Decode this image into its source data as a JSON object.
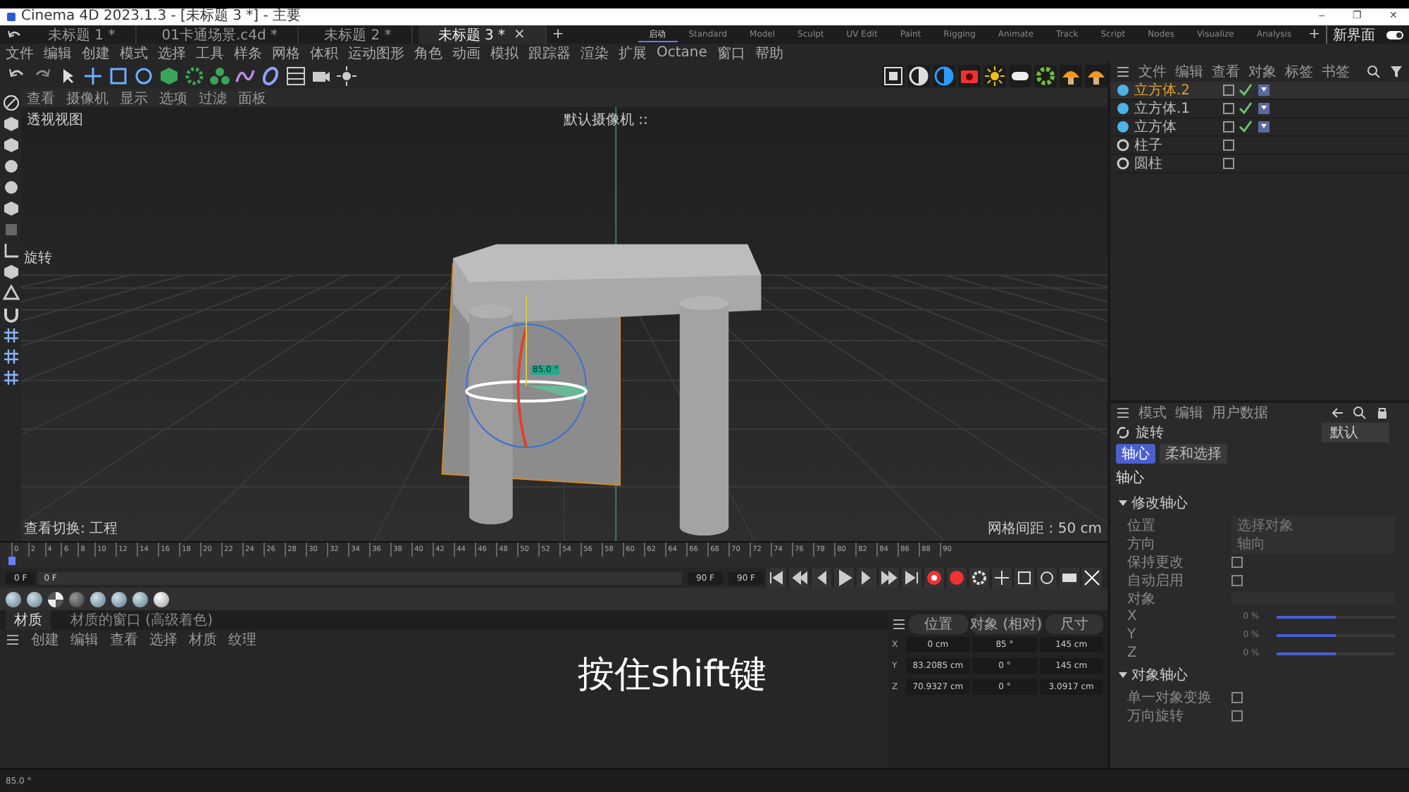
{
  "title_bar": {
    "title": "Cinema 4D 2023.1.3 - [未标题 3 *] - 主要",
    "controls": [
      "–",
      "❐",
      "✕"
    ]
  },
  "doc_tabs": {
    "items": [
      {
        "label": "未标题 1 *",
        "selected": false
      },
      {
        "label": "01卡通场景.c4d *",
        "selected": false
      },
      {
        "label": "未标题 2 *",
        "selected": false
      },
      {
        "label": "未标题 3 *",
        "selected": true
      }
    ],
    "close": "×",
    "add": "+"
  },
  "layouts": {
    "items": [
      {
        "label": "启动",
        "selected": true
      },
      {
        "label": "Standard",
        "selected": false
      },
      {
        "label": "Model",
        "selected": false
      },
      {
        "label": "Sculpt",
        "selected": false
      },
      {
        "label": "UV Edit",
        "selected": false
      },
      {
        "label": "Paint",
        "selected": false
      },
      {
        "label": "Rigging",
        "selected": false
      },
      {
        "label": "Animate",
        "selected": false
      },
      {
        "label": "Track",
        "selected": false
      },
      {
        "label": "Script",
        "selected": false
      },
      {
        "label": "Nodes",
        "selected": false
      },
      {
        "label": "Visualize",
        "selected": false
      },
      {
        "label": "Analysis",
        "selected": false
      }
    ],
    "add": "+",
    "new_layout": "新界面",
    "toggle_on": true
  },
  "menu": [
    "文件",
    "编辑",
    "创建",
    "模式",
    "选择",
    "工具",
    "样条",
    "网格",
    "体积",
    "运动图形",
    "角色",
    "动画",
    "模拟",
    "跟踪器",
    "渲染",
    "扩展",
    "Octane",
    "窗口",
    "帮助"
  ],
  "viewport": {
    "menu": [
      "查看",
      "摄像机",
      "显示",
      "选项",
      "过滤",
      "面板"
    ],
    "name": "透视视图",
    "camera": "默认摄像机 ::",
    "tool": "旋转",
    "grid": "网格间距 : 50 cm",
    "view_switch": "查看切换: 工程",
    "gizmo_label": "85.0 °"
  },
  "objects": {
    "menu": [
      "文件",
      "编辑",
      "查看",
      "对象",
      "标签",
      "书签"
    ],
    "items": [
      {
        "name": "立方体.2",
        "kind": "cube",
        "selected": true
      },
      {
        "name": "立方体.1",
        "kind": "cube",
        "selected": false
      },
      {
        "name": "立方体",
        "kind": "cube",
        "selected": false
      },
      {
        "name": "柱子",
        "kind": "null",
        "selected": false
      },
      {
        "name": "圆柱",
        "kind": "null",
        "selected": false
      }
    ]
  },
  "attributes": {
    "menu": [
      "模式",
      "编辑",
      "用户数据"
    ],
    "tool": "旋转",
    "preset": "默认",
    "tabs": [
      {
        "label": "轴心",
        "selected": true
      },
      {
        "label": "柔和选择",
        "selected": false
      }
    ],
    "heading": "轴心",
    "sections": [
      {
        "title": "修改轴心",
        "expanded": true,
        "rows": [
          {
            "kind": "dropdown",
            "label": "位置",
            "value": "选择对象"
          },
          {
            "kind": "dropdown",
            "label": "方向",
            "value": "轴向"
          },
          {
            "kind": "checkbox",
            "label": "保持更改",
            "checked": false
          },
          {
            "kind": "checkbox",
            "label": "自动启用",
            "checked": false
          },
          {
            "kind": "link",
            "label": "对象"
          },
          {
            "kind": "slider",
            "label": "X",
            "value": "0 %",
            "level": 0.5
          },
          {
            "kind": "slider",
            "label": "Y",
            "value": "0 %",
            "level": 0.5
          },
          {
            "kind": "slider",
            "label": "Z",
            "value": "0 %",
            "level": 0.5
          }
        ]
      },
      {
        "title": "对象轴心",
        "expanded": true,
        "rows": [
          {
            "kind": "checkbox",
            "label": "单一对象变换",
            "checked": false
          },
          {
            "kind": "checkbox",
            "label": "万向旋转",
            "checked": false
          }
        ]
      }
    ]
  },
  "timeline": {
    "ticks": [
      "0",
      "2",
      "4",
      "6",
      "8",
      "10",
      "12",
      "14",
      "16",
      "18",
      "20",
      "22",
      "24",
      "26",
      "28",
      "30",
      "32",
      "34",
      "36",
      "38",
      "40",
      "42",
      "44",
      "46",
      "48",
      "50",
      "52",
      "54",
      "56",
      "58",
      "60",
      "62",
      "64",
      "66",
      "68",
      "70",
      "72",
      "74",
      "76",
      "78",
      "80",
      "82",
      "84",
      "86",
      "88",
      "90"
    ],
    "level": 0,
    "start": "0 F",
    "current": "0 F",
    "end": "90 F",
    "preview_end": "90 F"
  },
  "material_manager": {
    "tabs": [
      {
        "label": "材质",
        "selected": true
      },
      {
        "label": "材质的窗口 (高级着色)",
        "selected": false
      }
    ],
    "menu": [
      "创建",
      "编辑",
      "查看",
      "选择",
      "材质",
      "纹理"
    ]
  },
  "coordinates": {
    "headers": [
      "位置",
      "对象 (相对)",
      "尺寸"
    ],
    "rows": [
      {
        "axis": "X",
        "values": [
          "0 cm",
          "85 °",
          "145 cm"
        ]
      },
      {
        "axis": "Y",
        "values": [
          "83.2085 cm",
          "0 °",
          "145 cm"
        ]
      },
      {
        "axis": "Z",
        "values": [
          "70.9327 cm",
          "0 °",
          "3.0917 cm"
        ]
      }
    ]
  },
  "subtitle": "按住shift键",
  "status_bar": {
    "text": "85.0 °"
  }
}
